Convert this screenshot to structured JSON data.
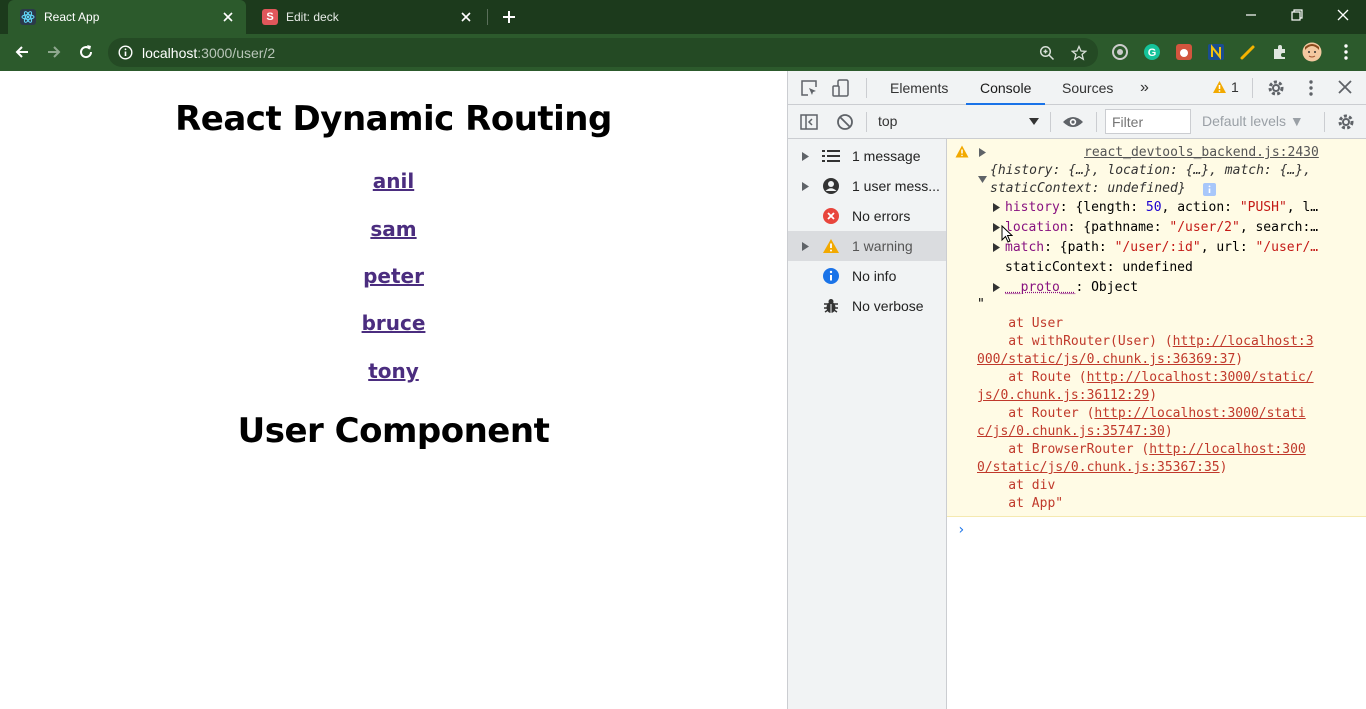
{
  "browser": {
    "tabs": [
      {
        "title": "React App",
        "favicon": "react-icon",
        "active": true
      },
      {
        "title": "Edit: deck",
        "favicon": "s-letter-icon",
        "favicon_letter": "S",
        "active": false
      }
    ],
    "url_host": "localhost",
    "url_rest": ":3000/user/2"
  },
  "page": {
    "heading": "React Dynamic Routing",
    "links": [
      "anil",
      "sam",
      "peter",
      "bruce",
      "tony"
    ],
    "component_heading": "User Component"
  },
  "devtools": {
    "tabs": [
      "Elements",
      "Console",
      "Sources"
    ],
    "active_tab": "Console",
    "more_tabs": "»",
    "warning_count": "1",
    "context": "top",
    "filter_placeholder": "Filter",
    "levels": "Default levels ▼",
    "sidebar": [
      {
        "arrow": true,
        "icon": "list-icon",
        "label": "1 message"
      },
      {
        "arrow": true,
        "icon": "user-icon",
        "label": "1 user mess..."
      },
      {
        "arrow": false,
        "icon": "error-icon",
        "label": "No errors"
      },
      {
        "arrow": true,
        "icon": "warning-icon",
        "label": "1 warning",
        "selected": true
      },
      {
        "arrow": false,
        "icon": "info-icon",
        "label": "No info"
      },
      {
        "arrow": false,
        "icon": "bug-icon",
        "label": "No verbose"
      }
    ],
    "console": {
      "source_link": "react_devtools_backend.js:2430",
      "summary_1": "{history: {…}, location: {…}, match: {…},",
      "summary_2": "staticContext: undefined}",
      "props": [
        {
          "key": "history",
          "sep": ": {length: ",
          "num": "50",
          "mid": ", action: ",
          "str": "\"PUSH\"",
          "tail": ", l…"
        },
        {
          "key": "location",
          "sep": ": {pathname: ",
          "str": "\"/user/2\"",
          "tail": ", search:…"
        },
        {
          "key": "match",
          "sep": ": {path: ",
          "str": "\"/user/:id\"",
          "mid": ", url: ",
          "str2": "\"/user/…"
        }
      ],
      "static_context": "staticContext: undefined",
      "proto_key": "__proto__",
      "proto_val": ": Object",
      "open_quote": "\"",
      "stack": [
        {
          "text": "    at User"
        },
        {
          "text": "    at withRouter(User) (",
          "link": "http://localhost:3"
        },
        {
          "cont": "000/static/js/0.chunk.js:36369:37",
          "close": ")"
        },
        {
          "text": "    at Route (",
          "link": "http://localhost:3000/static/"
        },
        {
          "cont": "js/0.chunk.js:36112:29",
          "close": ")"
        },
        {
          "text": "    at Router (",
          "link": "http://localhost:3000/stati"
        },
        {
          "cont": "c/js/0.chunk.js:35747:30",
          "close": ")"
        },
        {
          "text": "    at BrowserRouter (",
          "link": "http://localhost:300"
        },
        {
          "cont": "0/static/js/0.chunk.js:35367:35",
          "close": ")"
        },
        {
          "text": "    at div"
        },
        {
          "text": "    at App\""
        }
      ],
      "prompt": "›"
    }
  },
  "colors": {
    "chrome_dark": "#1c3a1c",
    "chrome_toolbar": "#2c5a2c",
    "link_purple": "#4b2d7f",
    "warning_bg": "#fffbe5",
    "devtools_accent": "#1a73e8"
  }
}
